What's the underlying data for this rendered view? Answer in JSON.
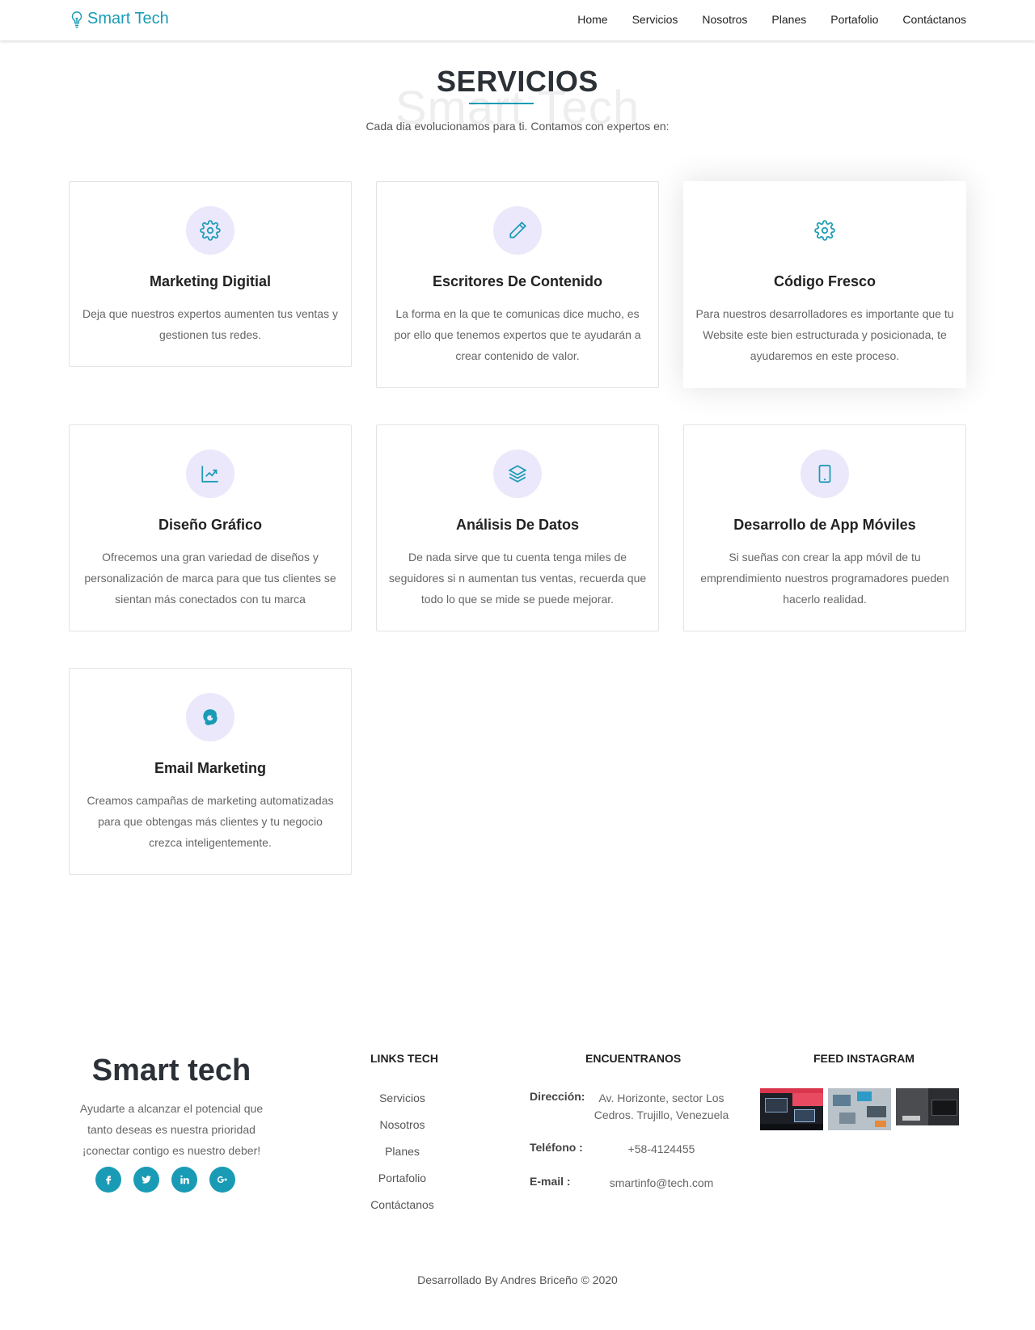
{
  "nav": {
    "brand": "Smart Tech",
    "links": [
      "Home",
      "Servicios",
      "Nosotros",
      "Planes",
      "Portafolio",
      "Contáctanos"
    ]
  },
  "services": {
    "title": "SERVICIOS",
    "watermark": "Smart Tech",
    "subtitle": "Cada dia evolucionamos para ti. Contamos con expertos en:",
    "items": [
      {
        "icon": "gear-icon",
        "title": "Marketing Digitial",
        "text": "Deja que nuestros expertos aumenten tus ventas y gestionen tus redes."
      },
      {
        "icon": "pencil-icon",
        "title": "Escritores De Contenido",
        "text": "La forma en la que te comunicas dice mucho, es por ello que tenemos expertos que te ayudarán a crear contenido de valor."
      },
      {
        "icon": "gear-icon",
        "title": "Código Fresco",
        "text": "Para nuestros desarrolladores es importante que tu Website este bien estructurada y posicionada, te ayudaremos en este proceso."
      },
      {
        "icon": "chart-line-icon",
        "title": "Diseño Gráfico",
        "text": "Ofrecemos una gran variedad de diseños y personalización de marca para que tus clientes se sientan más conectados con tu marca"
      },
      {
        "icon": "layers-icon",
        "title": "Análisis De Datos",
        "text": "De nada sirve que tu cuenta tenga miles de seguidores si n aumentan tus ventas, recuerda que todo lo que se mide se puede mejorar."
      },
      {
        "icon": "mobile-icon",
        "title": "Desarrollo de App Móviles",
        "text": "Si sueñas con crear la app móvil de tu emprendimiento nuestros programadores pueden hacerlo realidad."
      },
      {
        "icon": "mailchimp-icon",
        "title": "Email Marketing",
        "text": "Creamos campañas de marketing automatizadas para que obtengas más clientes y tu negocio crezca inteligentemente."
      }
    ]
  },
  "footer": {
    "brand": "Smart tech",
    "tagline": "Ayudarte a alcanzar el potencial que tanto deseas es nuestra prioridad ¡conectar contigo es nuestro deber!",
    "socials": [
      "facebook-icon",
      "twitter-icon",
      "linkedin-icon",
      "google-plus-icon"
    ],
    "links_title": "LINKS TECH",
    "links": [
      "Servicios",
      "Nosotros",
      "Planes",
      "Portafolio",
      "Contáctanos"
    ],
    "contact_title": "ENCUENTRANOS",
    "address_label": "Dirección:",
    "address": "Av. Horizonte, sector Los Cedros. Trujillo, Venezuela",
    "phone_label": "Teléfono :",
    "phone": "+58-4124455",
    "email_label": "E-mail :",
    "email": "smartinfo@tech.com",
    "instagram_title": "FEED INSTAGRAM",
    "copyright": "Desarrollado By Andres Briceño © 2020"
  }
}
